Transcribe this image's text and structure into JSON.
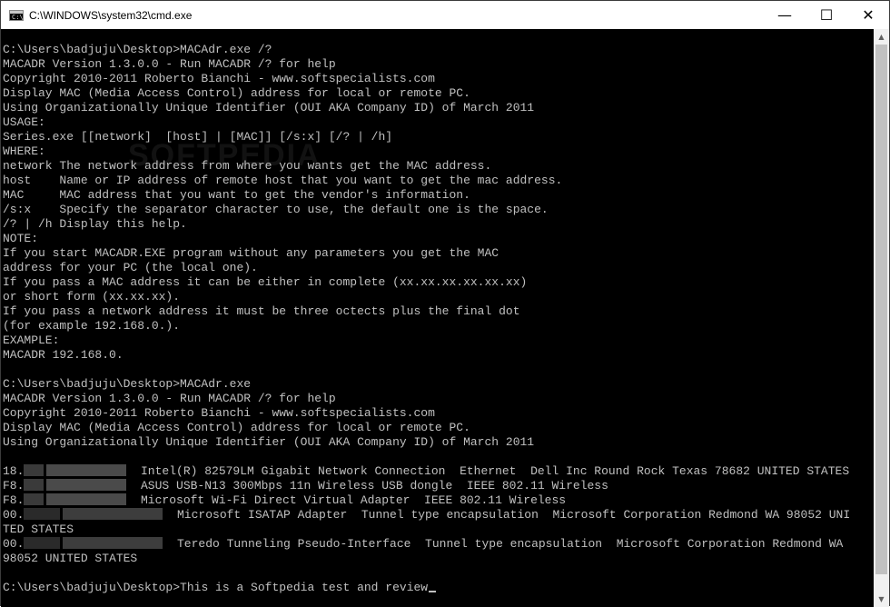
{
  "window": {
    "title": "C:\\WINDOWS\\system32\\cmd.exe",
    "icon_text": "C:\\",
    "minimize_glyph": "—",
    "maximize_glyph": "☐",
    "close_glyph": "✕"
  },
  "watermark": "SOFTPEDIA",
  "colors": {
    "console_bg": "#000000",
    "console_fg": "#c0c0c0",
    "titlebar_bg": "#ffffff"
  },
  "console": {
    "lines": [
      "C:\\Users\\badjuju\\Desktop>MACAdr.exe /?",
      "MACADR Version 1.3.0.0 - Run MACADR /? for help",
      "Copyright 2010-2011 Roberto Bianchi - www.softspecialists.com",
      "Display MAC (Media Access Control) address for local or remote PC.",
      "Using Organizationally Unique Identifier (OUI AKA Company ID) of March 2011",
      "USAGE:",
      "Series.exe [[network]  [host] | [MAC]] [/s:x] [/? | /h]",
      "WHERE:",
      "network The network address from where you wants get the MAC address.",
      "host    Name or IP address of remote host that you want to get the mac address.",
      "MAC     MAC address that you want to get the vendor's information.",
      "/s:x    Specify the separator character to use, the default one is the space.",
      "/? | /h Display this help.",
      "NOTE:",
      "If you start MACADR.EXE program without any parameters you get the MAC",
      "address for your PC (the local one).",
      "If you pass a MAC address it can be either in complete (xx.xx.xx.xx.xx.xx)",
      "or short form (xx.xx.xx).",
      "If you pass a network address it must be three octects plus the final dot",
      "(for example 192.168.0.).",
      "EXAMPLE:",
      "MACADR 192.168.0.",
      "",
      "C:\\Users\\badjuju\\Desktop>MACAdr.exe",
      "MACADR Version 1.3.0.0 - Run MACADR /? for help",
      "Copyright 2010-2011 Roberto Bianchi - www.softspecialists.com",
      "Display MAC (Media Access Control) address for local or remote PC.",
      "Using Organizationally Unique Identifier (OUI AKA Company ID) of March 2011",
      ""
    ],
    "results": [
      {
        "prefix": "18.",
        "blur": "short",
        "text": "  Intel(R) 82579LM Gigabit Network Connection  Ethernet  Dell Inc Round Rock Texas 78682 UNITED STATES"
      },
      {
        "prefix": "F8.",
        "blur": "short",
        "text": "  ASUS USB-N13 300Mbps 11n Wireless USB dongle  IEEE 802.11 Wireless"
      },
      {
        "prefix": "F8.",
        "blur": "short",
        "text": "  Microsoft Wi-Fi Direct Virtual Adapter  IEEE 802.11 Wireless"
      },
      {
        "prefix": "00.",
        "blur": "long",
        "text": "  Microsoft ISATAP Adapter  Tunnel type encapsulation  Microsoft Corporation Redmond WA 98052 UNI"
      },
      {
        "prefix": "",
        "blur": "none",
        "text": "TED STATES"
      },
      {
        "prefix": "00.",
        "blur": "long",
        "text": "  Teredo Tunneling Pseudo-Interface  Tunnel type encapsulation  Microsoft Corporation Redmond WA"
      },
      {
        "prefix": "",
        "blur": "none",
        "text": "98052 UNITED STATES"
      },
      {
        "prefix": "",
        "blur": "none",
        "text": ""
      }
    ],
    "prompt": "C:\\Users\\badjuju\\Desktop>",
    "typed": "This is a Softpedia test and review"
  },
  "scrollbar": {
    "up_glyph": "▲",
    "down_glyph": "▼"
  }
}
